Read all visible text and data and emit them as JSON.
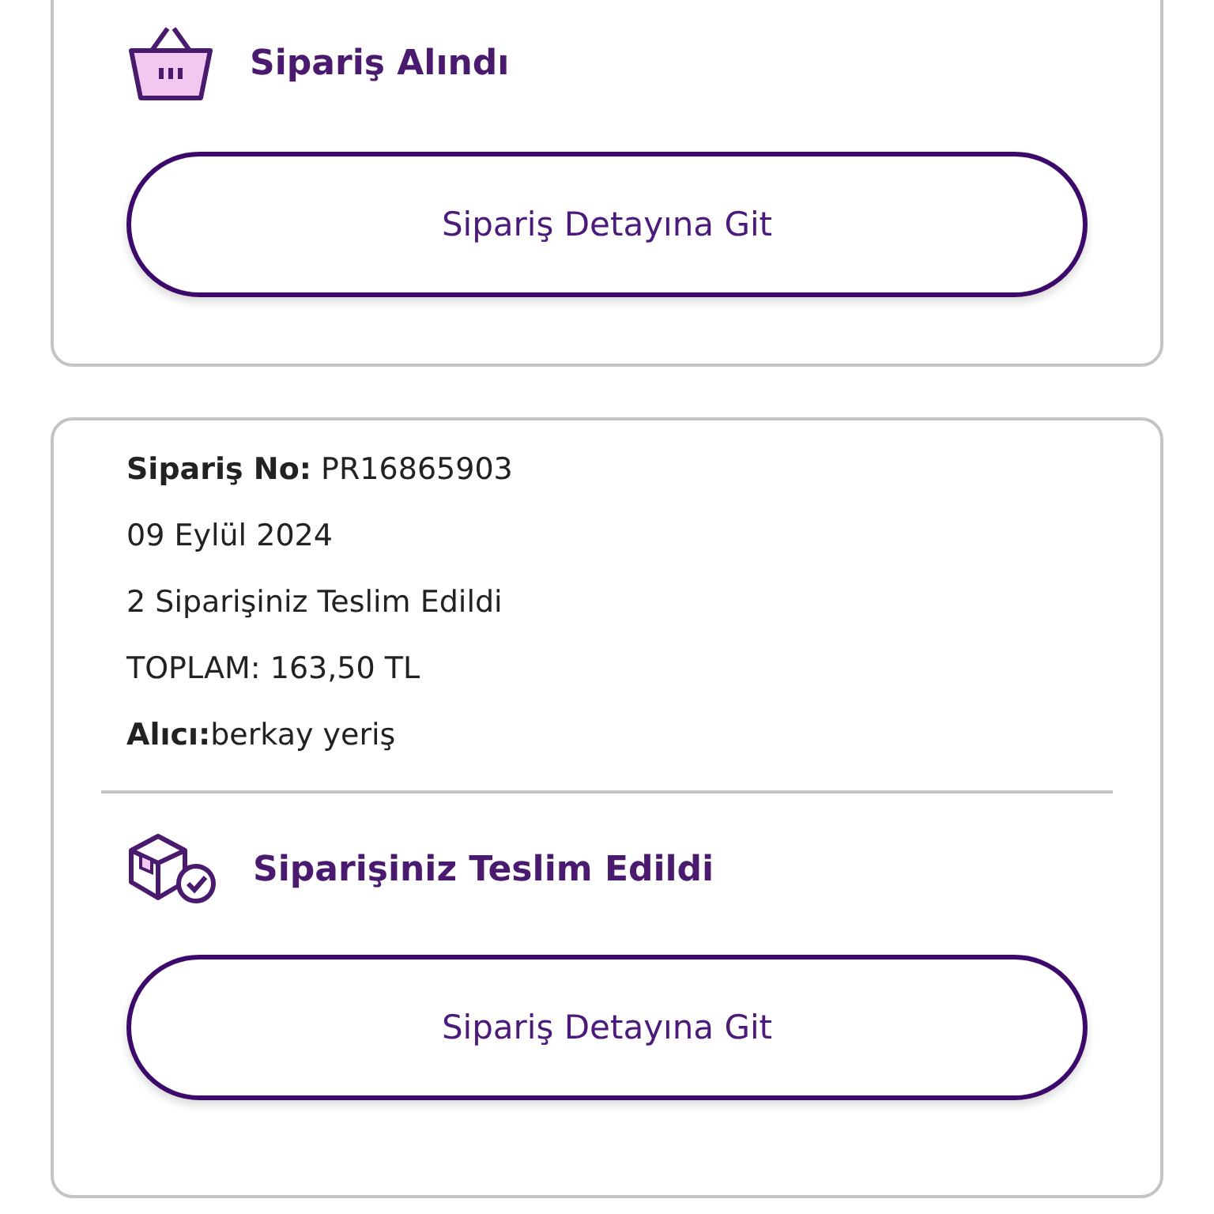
{
  "cards": [
    {
      "status": {
        "kind": "basket",
        "title": "Sipariş Alındı"
      },
      "button": "Sipariş Detayına Git"
    },
    {
      "details": [
        "**Sipariş No:** PR16865903",
        "09 Eylül 2024",
        "2 Siparişiniz Teslim Edildi",
        "TOPLAM: 163,50 TL",
        "**Alıcı:**berkay yeriş"
      ],
      "status": {
        "kind": "delivered",
        "title": "Siparişiniz Teslim Edildi"
      },
      "button": "Sipariş Detayına Git"
    }
  ]
}
